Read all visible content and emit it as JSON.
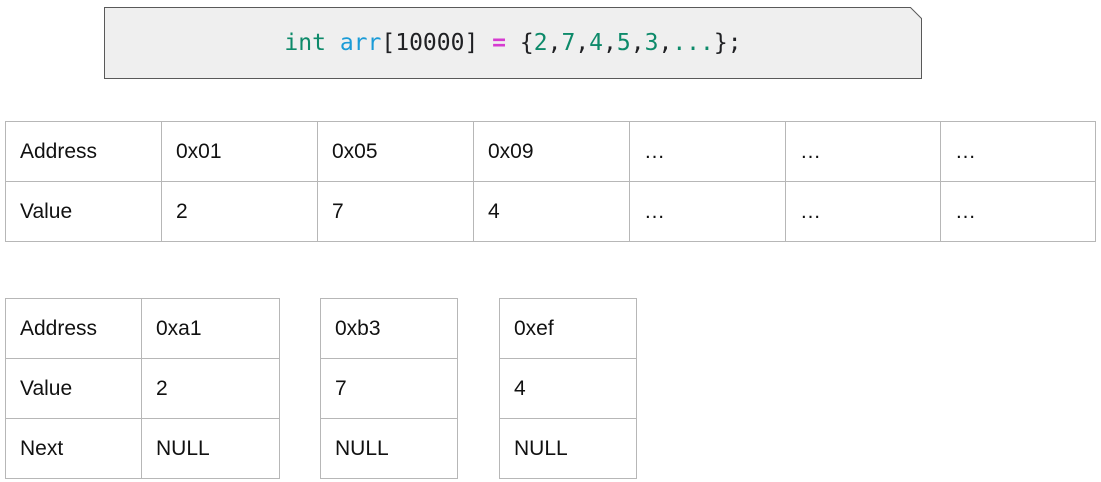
{
  "code": {
    "tokens": [
      {
        "text": "int",
        "kind": "kw"
      },
      {
        "text": " ",
        "kind": "plain"
      },
      {
        "text": "arr",
        "kind": "var"
      },
      {
        "text": "[10000] ",
        "kind": "plain"
      },
      {
        "text": "=",
        "kind": "op"
      },
      {
        "text": " {",
        "kind": "plain"
      },
      {
        "text": "2",
        "kind": "num"
      },
      {
        "text": ",",
        "kind": "plain"
      },
      {
        "text": "7",
        "kind": "num"
      },
      {
        "text": ",",
        "kind": "plain"
      },
      {
        "text": "4",
        "kind": "num"
      },
      {
        "text": ",",
        "kind": "plain"
      },
      {
        "text": "5",
        "kind": "num"
      },
      {
        "text": ",",
        "kind": "plain"
      },
      {
        "text": "3",
        "kind": "num"
      },
      {
        "text": ",",
        "kind": "plain"
      },
      {
        "text": "...",
        "kind": "num"
      },
      {
        "text": "};",
        "kind": "plain"
      }
    ],
    "colors": {
      "keyword": "#0d8a6a",
      "variable": "#1a9bd7",
      "operator": "#d63bd0",
      "box_fill": "#efefef",
      "box_border": "#595959"
    }
  },
  "array_table": {
    "rows": [
      {
        "label": "Address",
        "cells": [
          "0x01",
          "0x05",
          "0x09",
          "…",
          "…",
          "…"
        ]
      },
      {
        "label": "Value",
        "cells": [
          "2",
          "7",
          "4",
          "…",
          "…",
          "…"
        ]
      }
    ]
  },
  "linked_list": {
    "labels": [
      "Address",
      "Value",
      "Next"
    ],
    "nodes": [
      {
        "address": "0xa1",
        "value": "2",
        "next": "NULL"
      },
      {
        "address": "0xb3",
        "value": "7",
        "next": "NULL"
      },
      {
        "address": "0xef",
        "value": "4",
        "next": "NULL"
      }
    ]
  }
}
